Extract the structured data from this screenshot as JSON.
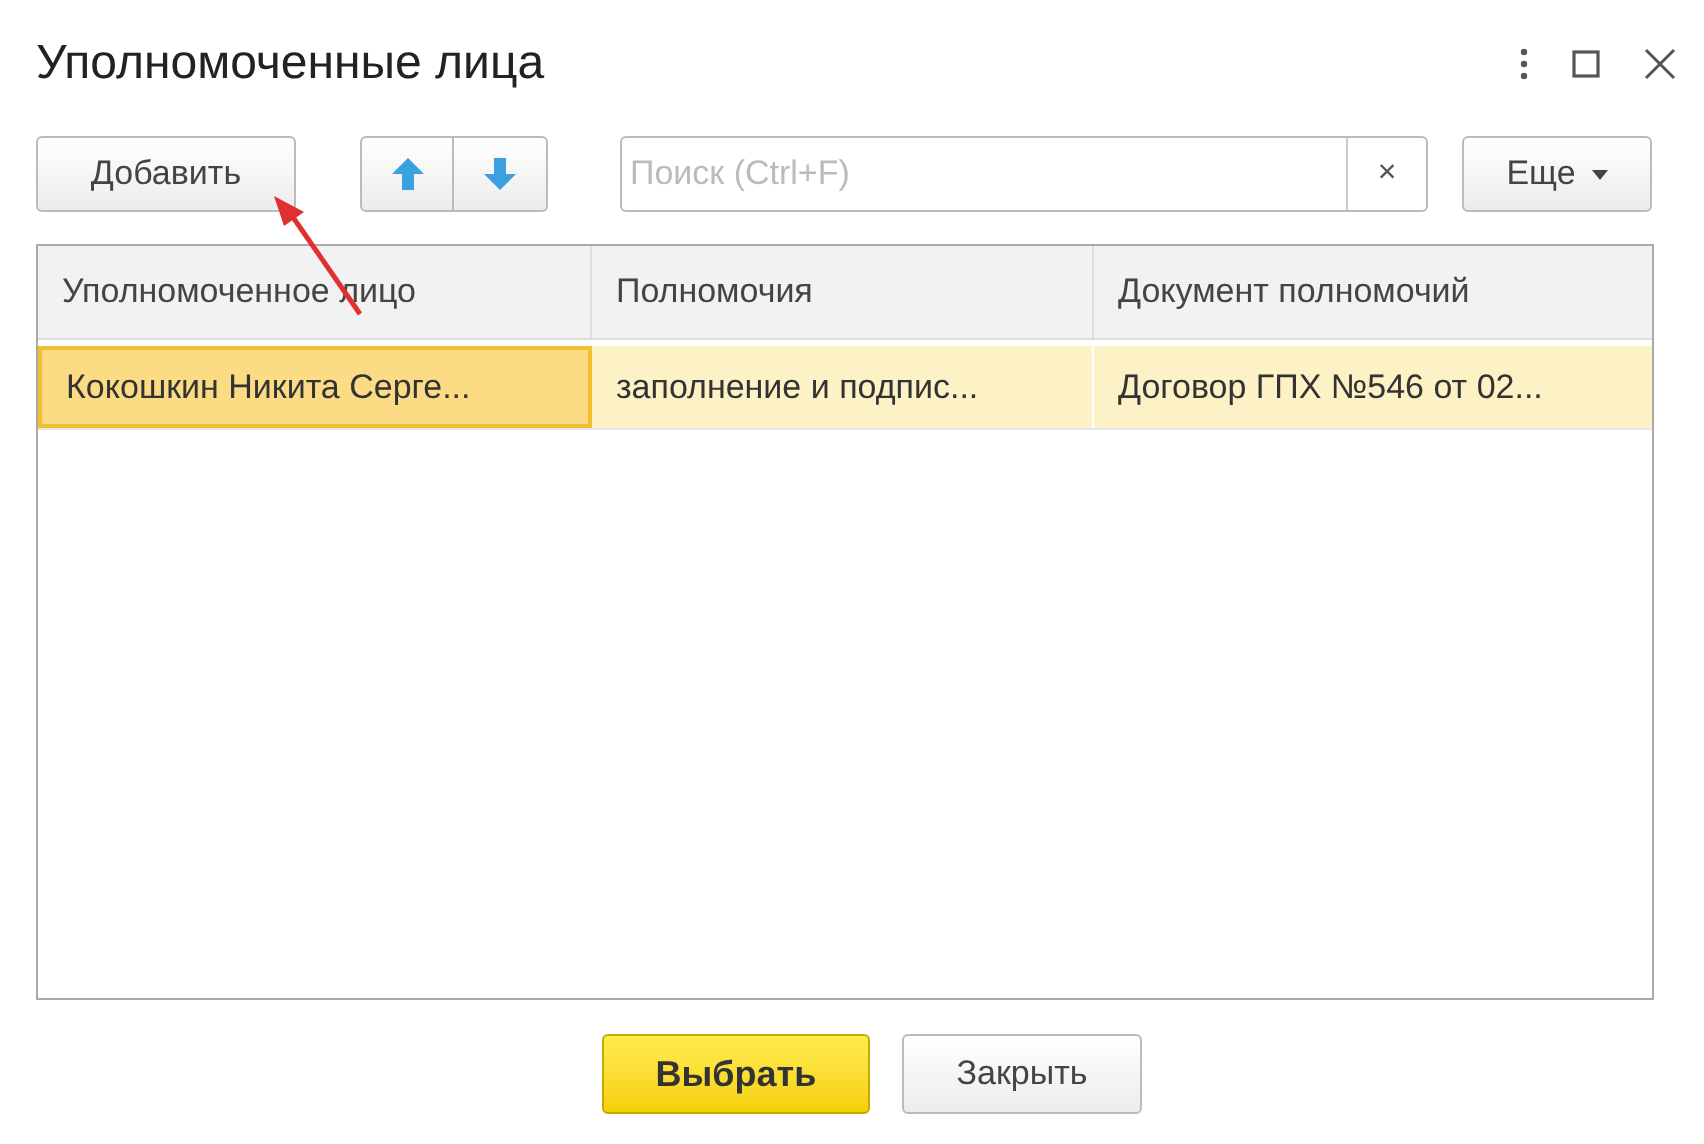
{
  "window": {
    "title": "Уполномоченные лица"
  },
  "toolbar": {
    "add_button": "Добавить",
    "search": {
      "placeholder": "Поиск (Ctrl+F)",
      "clear": "×"
    },
    "more_button": "Еще"
  },
  "table": {
    "columns": [
      "Уполномоченное лицо",
      "Полномочия",
      "Документ полномочий"
    ],
    "rows": [
      {
        "cells": [
          "Кокошкин Никита Серге...",
          "заполнение и подпис...",
          "Договор ГПХ №546 от 02..."
        ],
        "selected": true
      }
    ]
  },
  "footer": {
    "buttons": [
      {
        "label": "Выбрать",
        "kind": "primary"
      },
      {
        "label": "Закрыть",
        "kind": "secondary"
      }
    ]
  }
}
